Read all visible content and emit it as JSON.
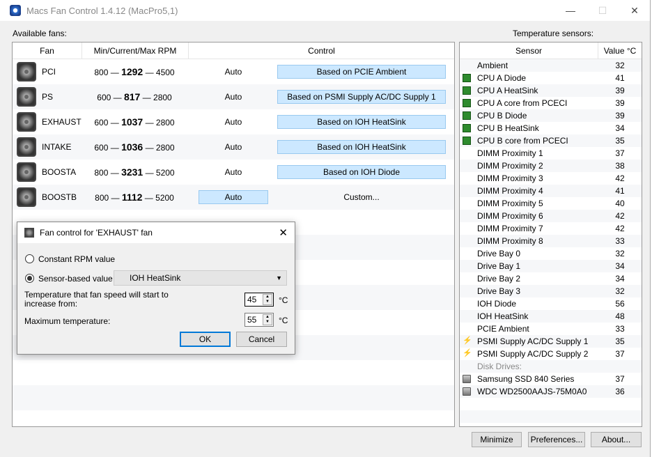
{
  "window": {
    "title": "Macs Fan Control 1.4.12 (MacPro5,1)",
    "minimize": "—",
    "maximize": "☐",
    "close": "✕"
  },
  "fans": {
    "label": "Available fans:",
    "headers": {
      "fan": "Fan",
      "rpm": "Min/Current/Max RPM",
      "control": "Control"
    },
    "rows": [
      {
        "name": "PCI",
        "min": "800",
        "current": "1292",
        "max": "4500",
        "mode": "Auto",
        "control": "Based on PCIE Ambient",
        "selected": "control"
      },
      {
        "name": "PS",
        "min": "600",
        "current": "817",
        "max": "2800",
        "mode": "Auto",
        "control": "Based on PSMI Supply AC/DC Supply 1",
        "selected": "control"
      },
      {
        "name": "EXHAUST",
        "min": "600",
        "current": "1037",
        "max": "2800",
        "mode": "Auto",
        "control": "Based on IOH HeatSink",
        "selected": "control"
      },
      {
        "name": "INTAKE",
        "min": "600",
        "current": "1036",
        "max": "2800",
        "mode": "Auto",
        "control": "Based on IOH HeatSink",
        "selected": "control"
      },
      {
        "name": "BOOSTA",
        "min": "800",
        "current": "3231",
        "max": "5200",
        "mode": "Auto",
        "control": "Based on IOH Diode",
        "selected": "control"
      },
      {
        "name": "BOOSTB",
        "min": "800",
        "current": "1112",
        "max": "5200",
        "mode": "Auto",
        "control": "Custom...",
        "selected": "mode"
      }
    ]
  },
  "sensors": {
    "label": "Temperature sensors:",
    "headers": {
      "sensor": "Sensor",
      "value": "Value °C"
    },
    "rows": [
      {
        "name": "Ambient",
        "value": "32",
        "icon": "none"
      },
      {
        "name": "CPU A Diode",
        "value": "41",
        "icon": "chip"
      },
      {
        "name": "CPU A HeatSink",
        "value": "39",
        "icon": "chip"
      },
      {
        "name": "CPU A core from PCECI",
        "value": "39",
        "icon": "chip"
      },
      {
        "name": "CPU B Diode",
        "value": "39",
        "icon": "chip"
      },
      {
        "name": "CPU B HeatSink",
        "value": "34",
        "icon": "chip"
      },
      {
        "name": "CPU B core from PCECI",
        "value": "35",
        "icon": "chip"
      },
      {
        "name": "DIMM Proximity 1",
        "value": "37",
        "icon": "none"
      },
      {
        "name": "DIMM Proximity 2",
        "value": "38",
        "icon": "none"
      },
      {
        "name": "DIMM Proximity 3",
        "value": "42",
        "icon": "none"
      },
      {
        "name": "DIMM Proximity 4",
        "value": "41",
        "icon": "none"
      },
      {
        "name": "DIMM Proximity 5",
        "value": "40",
        "icon": "none"
      },
      {
        "name": "DIMM Proximity 6",
        "value": "42",
        "icon": "none"
      },
      {
        "name": "DIMM Proximity 7",
        "value": "42",
        "icon": "none"
      },
      {
        "name": "DIMM Proximity 8",
        "value": "33",
        "icon": "none"
      },
      {
        "name": "Drive Bay 0",
        "value": "32",
        "icon": "none"
      },
      {
        "name": "Drive Bay 1",
        "value": "34",
        "icon": "none"
      },
      {
        "name": "Drive Bay 2",
        "value": "34",
        "icon": "none"
      },
      {
        "name": "Drive Bay 3",
        "value": "32",
        "icon": "none"
      },
      {
        "name": "IOH Diode",
        "value": "56",
        "icon": "none"
      },
      {
        "name": "IOH HeatSink",
        "value": "48",
        "icon": "none"
      },
      {
        "name": "PCIE Ambient",
        "value": "33",
        "icon": "none"
      },
      {
        "name": "PSMI Supply AC/DC Supply 1",
        "value": "35",
        "icon": "bolt"
      },
      {
        "name": "PSMI Supply AC/DC Supply 2",
        "value": "37",
        "icon": "bolt"
      },
      {
        "name": "Disk Drives:",
        "value": "",
        "icon": "group"
      },
      {
        "name": "Samsung SSD 840 Series",
        "value": "37",
        "icon": "disk"
      },
      {
        "name": "WDC WD2500AAJS-75M0A0",
        "value": "36",
        "icon": "disk"
      }
    ]
  },
  "buttons": {
    "minimize": "Minimize",
    "preferences": "Preferences...",
    "about": "About..."
  },
  "dialog": {
    "title": "Fan control for 'EXHAUST' fan",
    "close": "✕",
    "constant_label": "Constant RPM value",
    "sensor_label": "Sensor-based value",
    "sensor_selected": "IOH HeatSink",
    "start_label": "Temperature that fan speed will start to increase from:",
    "start_value": "45",
    "max_label": "Maximum temperature:",
    "max_value": "55",
    "unit": "°C",
    "ok": "OK",
    "cancel": "Cancel",
    "mode": "sensor"
  }
}
